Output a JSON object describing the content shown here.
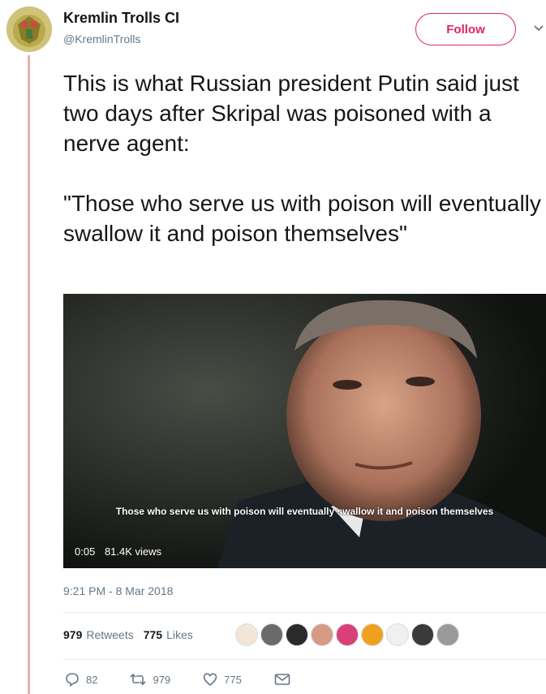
{
  "header": {
    "display_name": "Kremlin Trolls CI",
    "handle": "@KremlinTrolls",
    "follow_label": "Follow"
  },
  "tweet": {
    "text": "This is what Russian president Putin said just two days after Skripal was poisoned with a nerve agent:\n\n\"Those who serve us with poison will eventually swallow it and poison themselves\""
  },
  "video": {
    "subtitle": "Those who serve us with poison will eventually swallow it and poison themselves",
    "duration": "0:05",
    "views": "81.4K views"
  },
  "timestamp": "9:21 PM - 8 Mar 2018",
  "stats": {
    "retweets_count": "979",
    "retweets_label": "Retweets",
    "likes_count": "775",
    "likes_label": "Likes"
  },
  "actions": {
    "reply_count": "82",
    "retweet_count": "979",
    "like_count": "775"
  },
  "colors": {
    "accent": "#e0245e",
    "thread_line": "#e9b0b4",
    "muted": "#657786"
  }
}
